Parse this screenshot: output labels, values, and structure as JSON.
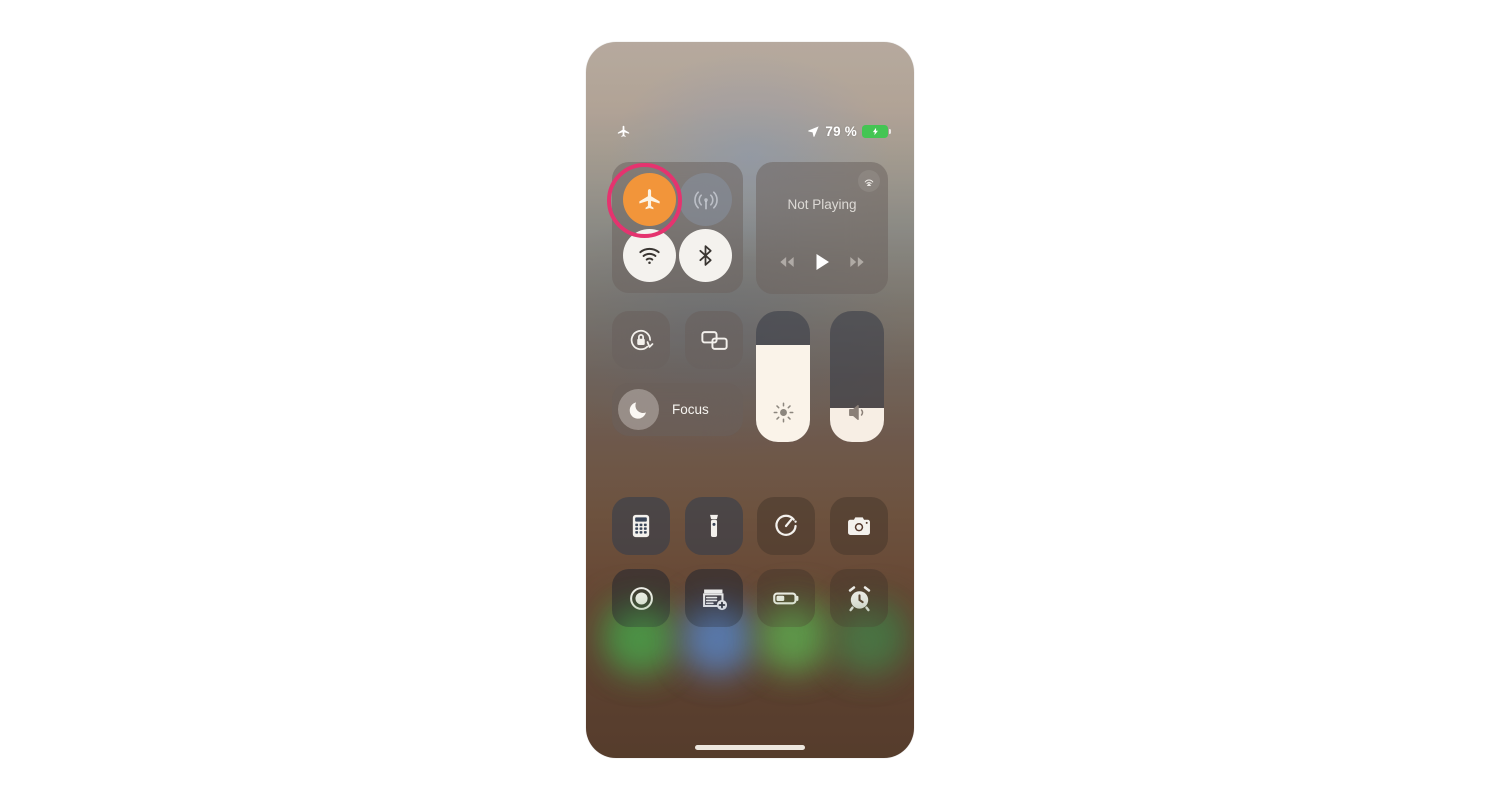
{
  "device": {
    "screen_label": "iPhone Control Center",
    "colors": {
      "highlight_ring": "#e5336f",
      "airplane_active": "#f2953a",
      "toggle_on": "#f4f2ee",
      "toggle_off": "#8892a2",
      "battery_charging": "#44c553",
      "slider_fill": "#faf3e9"
    }
  },
  "status_bar": {
    "left_icon": "airplane-icon",
    "location_icon": "location-arrow-icon",
    "battery_percent": "79 %",
    "battery_icon": "battery-charging-icon",
    "charging": true
  },
  "connectivity": {
    "module_name": "connectivity-module",
    "toggles": [
      {
        "id": "airplane",
        "icon": "airplane-icon",
        "label": "Airplane Mode",
        "state": "on",
        "style": "orange",
        "highlighted": true
      },
      {
        "id": "cellular",
        "icon": "cellular-icon",
        "label": "Cellular Data",
        "state": "off",
        "style": "dimmed",
        "highlighted": false
      },
      {
        "id": "wifi",
        "icon": "wifi-icon",
        "label": "Wi-Fi",
        "state": "on",
        "style": "white",
        "highlighted": false
      },
      {
        "id": "bluetooth",
        "icon": "bluetooth-icon",
        "label": "Bluetooth",
        "state": "on",
        "style": "white",
        "highlighted": false
      }
    ]
  },
  "media": {
    "module_name": "now-playing-module",
    "title": "Not Playing",
    "airplay_icon": "airplay-icon",
    "controls": [
      {
        "id": "rewind",
        "icon": "rewind-icon",
        "label": "Rewind"
      },
      {
        "id": "play",
        "icon": "play-icon",
        "label": "Play"
      },
      {
        "id": "forward",
        "icon": "forward-icon",
        "label": "Fast Forward"
      }
    ]
  },
  "quick_toggles": [
    {
      "id": "rotation-lock",
      "icon": "rotation-lock-icon",
      "label": "Portrait Orientation Lock"
    },
    {
      "id": "screen-mirror",
      "icon": "screen-mirroring-icon",
      "label": "Screen Mirroring"
    }
  ],
  "focus": {
    "label": "Focus",
    "icon": "moon-icon"
  },
  "sliders": [
    {
      "id": "brightness",
      "icon": "brightness-icon",
      "label": "Display Brightness",
      "value": 74
    },
    {
      "id": "volume",
      "icon": "volume-icon",
      "label": "Volume",
      "value": 26
    }
  ],
  "tiles": [
    {
      "id": "calculator",
      "icon": "calculator-icon",
      "label": "Calculator",
      "tone": "cool"
    },
    {
      "id": "flashlight",
      "icon": "flashlight-icon",
      "label": "Flashlight",
      "tone": "cool"
    },
    {
      "id": "timer",
      "icon": "timer-icon",
      "label": "Timer",
      "tone": "warm"
    },
    {
      "id": "camera",
      "icon": "camera-icon",
      "label": "Camera",
      "tone": "warm"
    },
    {
      "id": "screen-recording",
      "icon": "screen-record-icon",
      "label": "Screen Recording",
      "tone": "dark"
    },
    {
      "id": "notes",
      "icon": "new-note-icon",
      "label": "Notes",
      "tone": "dark"
    },
    {
      "id": "low-power-mode",
      "icon": "low-power-battery-icon",
      "label": "Low Power Mode",
      "tone": "warm"
    },
    {
      "id": "alarm",
      "icon": "alarm-clock-icon",
      "label": "Alarm",
      "tone": "warm"
    }
  ],
  "dock": {
    "blobs": [
      {
        "id": "app-1",
        "color": "#4f9b4a"
      },
      {
        "id": "app-2",
        "color": "#5c7fb4"
      },
      {
        "id": "app-3",
        "color": "#62a04e"
      },
      {
        "id": "app-4",
        "color": "#4d7a47"
      }
    ]
  },
  "home_indicator": {
    "label": "Home Indicator"
  }
}
